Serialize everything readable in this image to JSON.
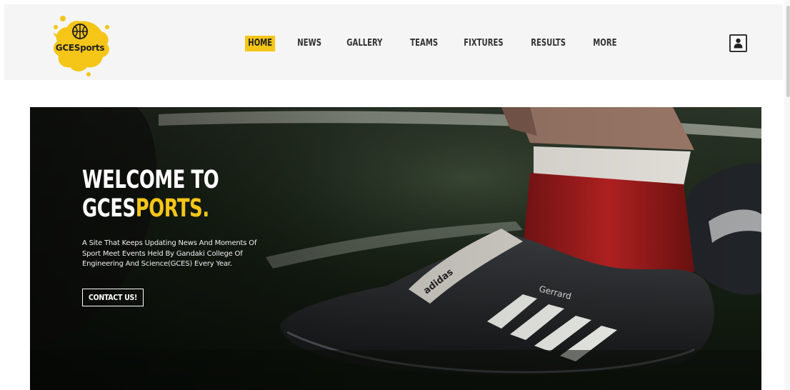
{
  "brand": {
    "logo_text": "GCESports",
    "accent_color": "#f5c518"
  },
  "nav": {
    "items": [
      {
        "label": "HOME",
        "active": true
      },
      {
        "label": "NEWS"
      },
      {
        "label": "GALLERY"
      },
      {
        "label": "TEAMS"
      },
      {
        "label": "FIXTURES"
      },
      {
        "label": "RESULTS"
      },
      {
        "label": "MORE"
      }
    ],
    "user_icon": "user-icon"
  },
  "hero": {
    "title_line1": "WELCOME TO",
    "title_line2_prefix": "GCES",
    "title_line2_accent": "PORTS.",
    "description": "A Site That Keeps Updating News And Moments Of Sport Meet Events Held By Gandaki College Of Engineering And Science(GCES) Every Year.",
    "cta_label": "CONTACT US!",
    "shoe_brand": "adidas",
    "shoe_name": "Gerrard"
  }
}
